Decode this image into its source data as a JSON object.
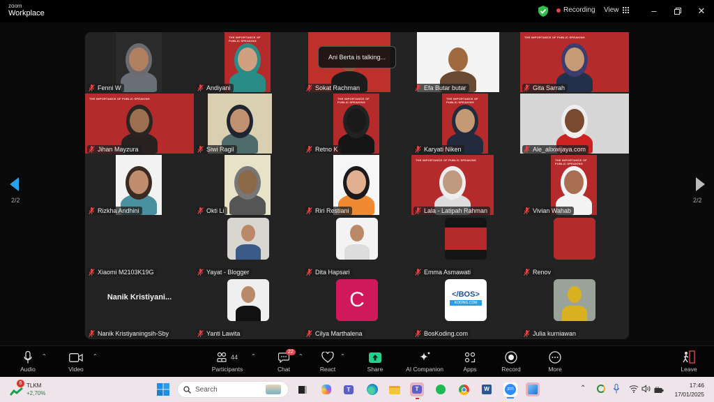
{
  "app": {
    "brand_small": "zoom",
    "brand": "Workplace"
  },
  "titlebar": {
    "recording_label": "Recording",
    "view_label": "View",
    "icons": [
      "shield-check-icon",
      "grid-icon",
      "minimize-icon",
      "restore-icon",
      "close-icon"
    ]
  },
  "colors": {
    "accent_blue": "#2aa0ea",
    "recording_red": "#e0454b",
    "share_green": "#23d18b",
    "slide_red": "#b52a2a",
    "avatar_pink": "#d0195a"
  },
  "stage": {
    "talking_banner": "Ani Berta is talking...",
    "page_left": "2/2",
    "page_right": "2/2",
    "slide_caption": "THE IMPORTANCE OF PUBLIC SPEAKING",
    "participants": [
      {
        "name": "Fenni W",
        "kind": "video"
      },
      {
        "name": "Andiyani",
        "kind": "slide-video"
      },
      {
        "name": "Sokat Rachman",
        "kind": "slide-video"
      },
      {
        "name": "Efa Butar butar",
        "kind": "video"
      },
      {
        "name": "Gita Sarrah",
        "kind": "slide-video"
      },
      {
        "name": "Jihan Mayzura",
        "kind": "slide-video"
      },
      {
        "name": "Siwi Ragil",
        "kind": "video"
      },
      {
        "name": "Retno K",
        "kind": "slide-video"
      },
      {
        "name": "Karyati Niken",
        "kind": "slide-video"
      },
      {
        "name": "Ale_alixwijaya.com",
        "kind": "video"
      },
      {
        "name": "Rizkha Andhini",
        "kind": "video"
      },
      {
        "name": "Okti Li",
        "kind": "video"
      },
      {
        "name": "Riri Restiani",
        "kind": "video"
      },
      {
        "name": "Lala - Latipah Rahman",
        "kind": "slide-video"
      },
      {
        "name": "Vivian Wahab",
        "kind": "slide-video"
      },
      {
        "name": "Xiaomi M2103K19G",
        "kind": "none"
      },
      {
        "name": "Yayat - Blogger",
        "kind": "photo"
      },
      {
        "name": "Dita Hapsari",
        "kind": "photo"
      },
      {
        "name": "Emma Asmawati",
        "kind": "photo"
      },
      {
        "name": "Renov",
        "kind": "photo"
      },
      {
        "name": "Nanik Kristiyaningsih-Sby",
        "kind": "text",
        "display": "Nanik  Kristiyani..."
      },
      {
        "name": "Yanti Lawita",
        "kind": "photo"
      },
      {
        "name": "Cilya Marthalena",
        "kind": "initial",
        "initial": "C"
      },
      {
        "name": "BosKoding.com",
        "kind": "logo",
        "logo_top": "</BOS>",
        "logo_bottom": "KODING.COM"
      },
      {
        "name": "Julia kurniawan",
        "kind": "photo"
      }
    ]
  },
  "toolbar": {
    "audio": "Audio",
    "video": "Video",
    "participants": "Participants",
    "participants_count": "44",
    "chat": "Chat",
    "chat_badge": "22",
    "react": "React",
    "share": "Share",
    "ai_companion": "AI Companion",
    "apps": "Apps",
    "record": "Record",
    "more": "More",
    "leave": "Leave"
  },
  "taskbar": {
    "stock_ticker": "TLKM",
    "stock_change": "+2,70%",
    "stock_badge": "6",
    "search_placeholder": "Search",
    "time": "17:46",
    "date": "17/01/2025",
    "pinned_apps": [
      "windows-start",
      "task-view",
      "copilot",
      "teams",
      "edge",
      "file-explorer",
      "teams-active",
      "spotify",
      "chrome",
      "word",
      "zoom",
      "photos"
    ]
  }
}
